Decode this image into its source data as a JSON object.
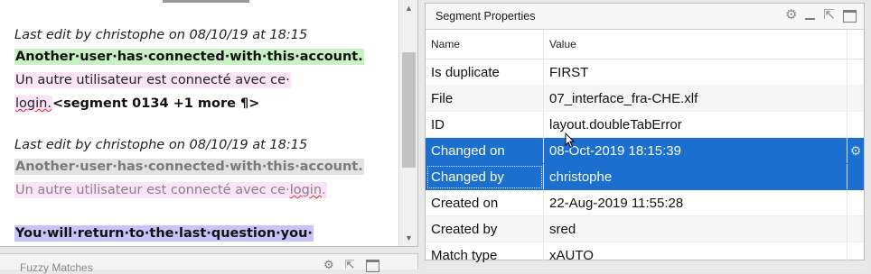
{
  "editor": {
    "segments": [
      {
        "meta": "Last edit by christophe on 08/10/19 at 18:15",
        "source": "Another·user·has·connected·with·this·account.",
        "target_line1": "Un autre utilisateur est connecté avec ce·",
        "target_line2": "login.",
        "tag": "<segment 0134 +1 more ¶>"
      },
      {
        "meta": "Last edit by christophe on 08/10/19 at 18:15",
        "source": "Another·user·has·connected·with·this·account.",
        "target_prefix": "Un autre utilisateur est connecté avec ce·",
        "target_word": "login",
        "target_suffix": "."
      },
      {
        "source": "You·will·return·to·the·last·question·you·"
      }
    ]
  },
  "fuzzy": {
    "title": "Fuzzy Matches"
  },
  "props": {
    "title": "Segment Properties",
    "columns": [
      "Name",
      "Value"
    ],
    "rows": [
      {
        "name": "Is duplicate",
        "value": "FIRST"
      },
      {
        "name": "File",
        "value": "07_interface_fra-CHE.xlf"
      },
      {
        "name": "ID",
        "value": "layout.doubleTabError"
      },
      {
        "name": "Changed on",
        "value": "08-Oct-2019 18:15:39"
      },
      {
        "name": "Changed by",
        "value": "christophe"
      },
      {
        "name": "Created on",
        "value": "22-Aug-2019 11:55:28"
      },
      {
        "name": "Created by",
        "value": "sred"
      },
      {
        "name": "Match type",
        "value": "xAUTO"
      }
    ]
  },
  "colors": {
    "selection": "#1a6fcf",
    "source_highlight": "#c9f2c4",
    "target_highlight": "#fbe4f7",
    "active_highlight": "#c9c4f7"
  },
  "icons": [
    "gear-icon",
    "minimize-icon",
    "restore-icon",
    "maximize-icon",
    "scroll-up-icon",
    "scroll-down-icon"
  ]
}
